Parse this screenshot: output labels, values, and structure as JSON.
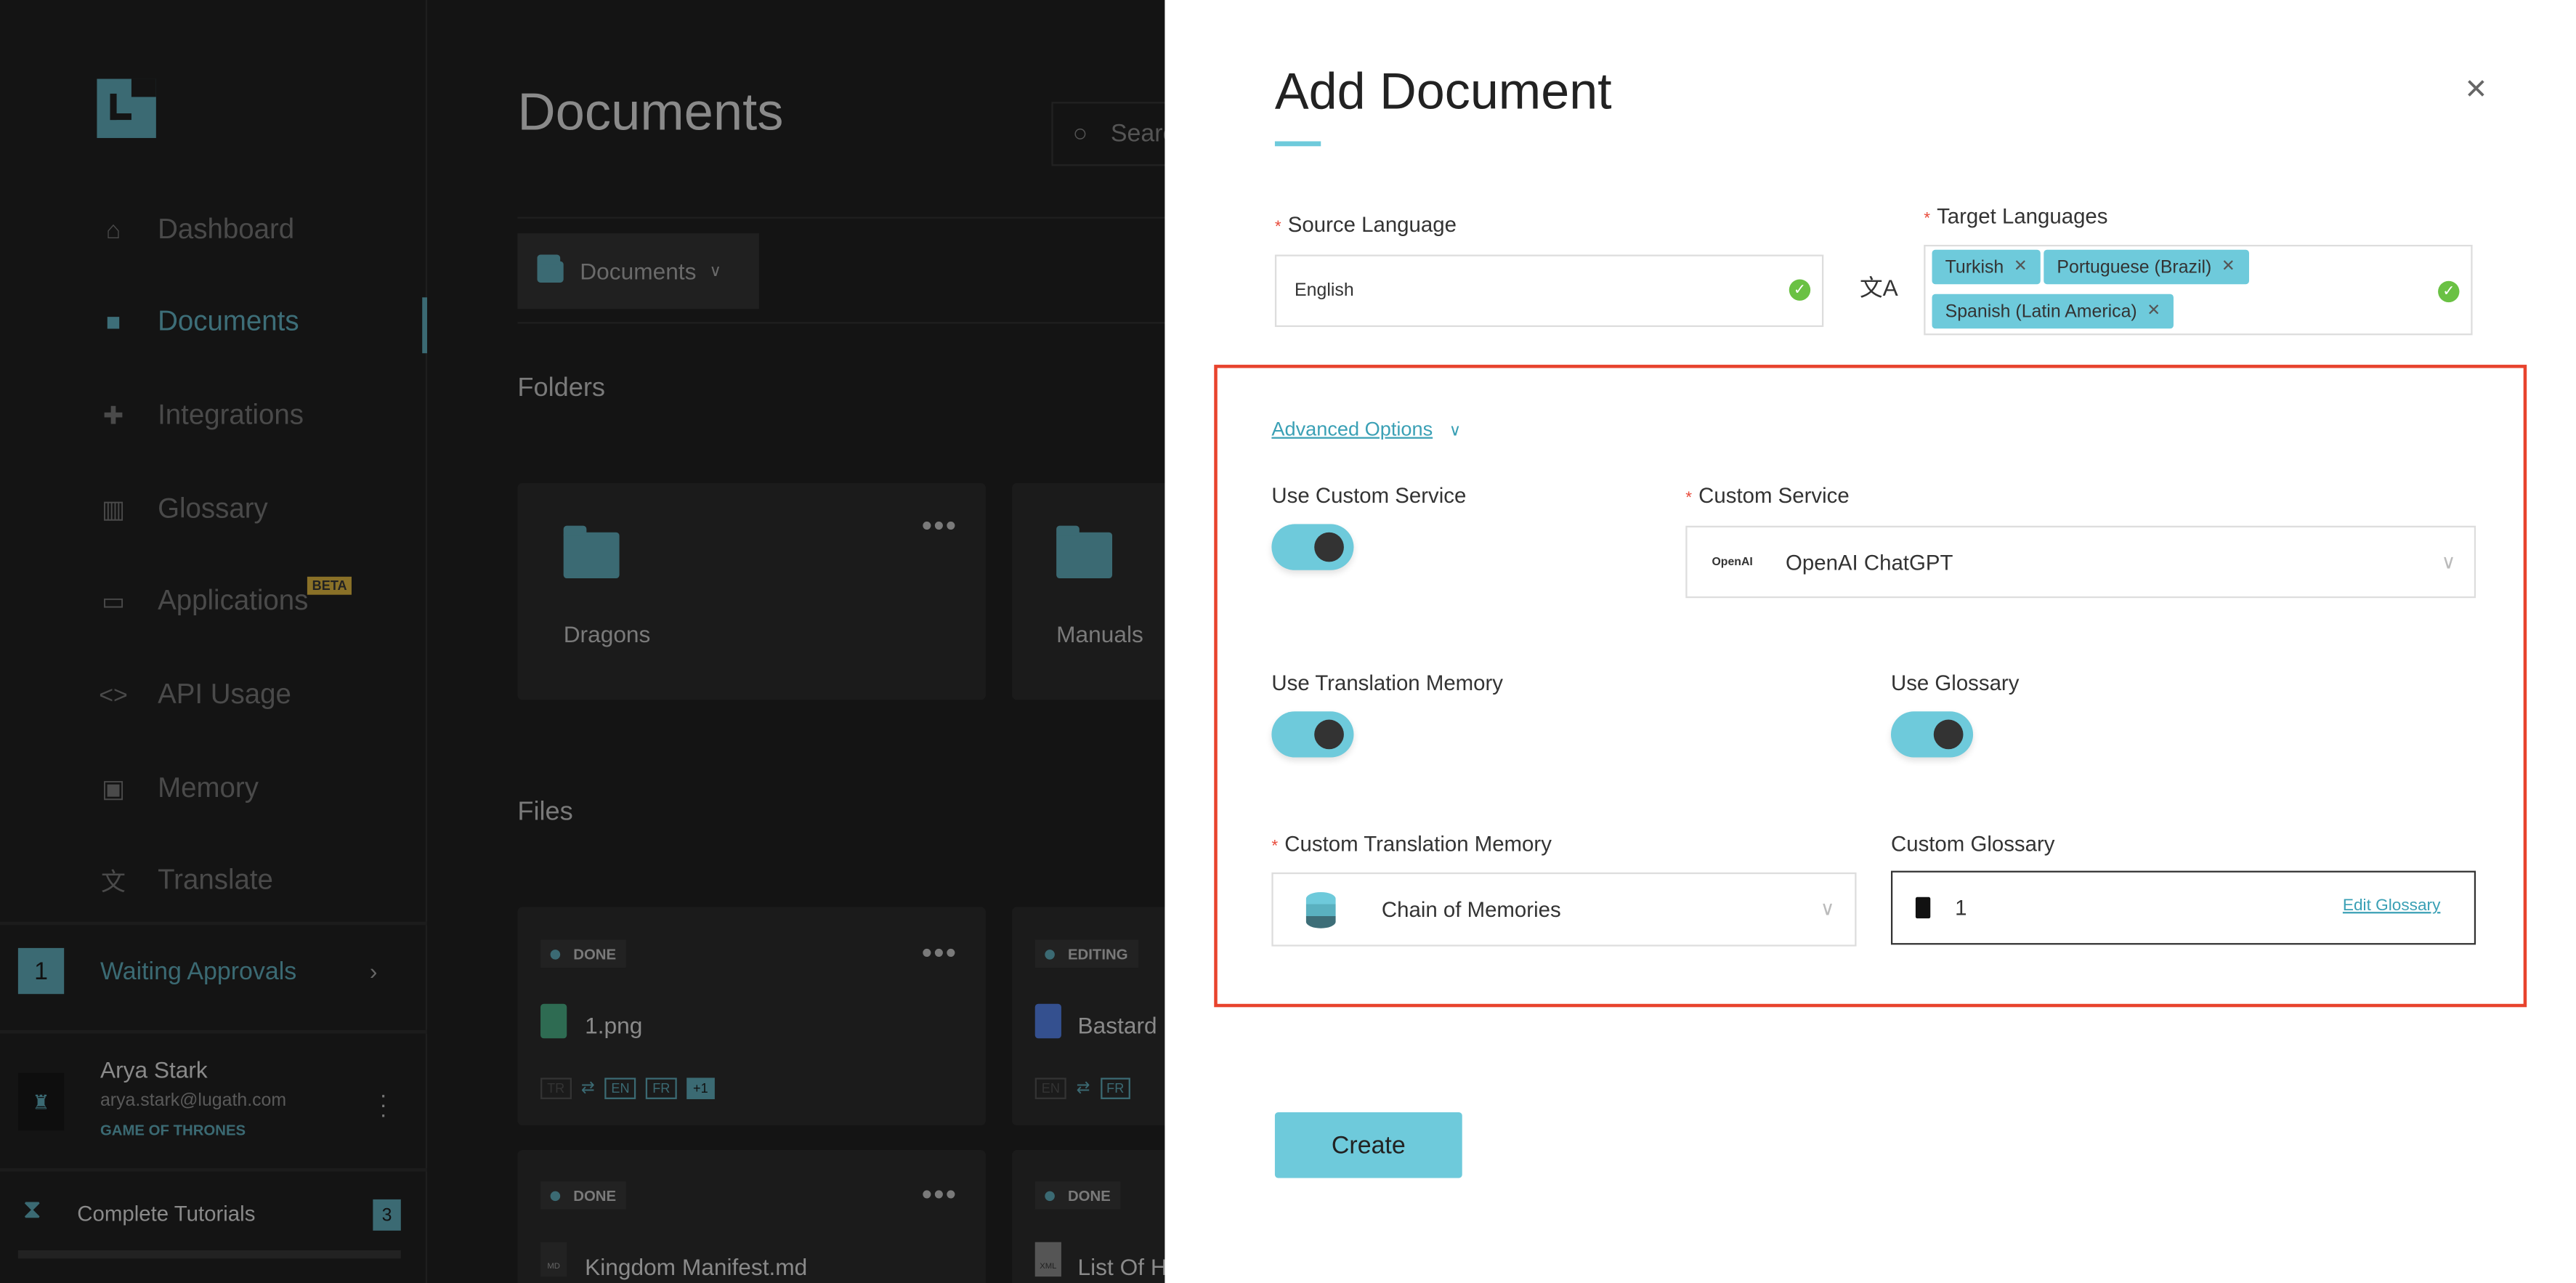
{
  "sidebar": {
    "items": [
      {
        "label": "Dashboard",
        "icon": "home-icon"
      },
      {
        "label": "Documents",
        "icon": "folder-icon",
        "active": true
      },
      {
        "label": "Integrations",
        "icon": "puzzle-icon"
      },
      {
        "label": "Glossary",
        "icon": "book-icon"
      },
      {
        "label": "Applications",
        "icon": "devices-icon",
        "badge": "BETA"
      },
      {
        "label": "API Usage",
        "icon": "code-icon"
      },
      {
        "label": "Memory",
        "icon": "chip-icon"
      },
      {
        "label": "Translate",
        "icon": "translate-icon"
      }
    ],
    "approvals": {
      "count": "1",
      "label": "Waiting Approvals"
    },
    "user": {
      "name": "Arya Stark",
      "email": "arya.stark@lugath.com",
      "org": "GAME OF THRONES"
    },
    "tutorials": {
      "label": "Complete Tutorials",
      "count": "3"
    }
  },
  "main": {
    "title": "Documents",
    "search_placeholder": "Search",
    "breadcrumb": "Documents",
    "folders_heading": "Folders",
    "folders": [
      "Dragons",
      "Manuals"
    ],
    "files_heading": "Files",
    "files": [
      {
        "status": "DONE",
        "name": "1.png",
        "langs": [
          "TR",
          "EN",
          "FR",
          "+1"
        ]
      },
      {
        "status": "EDITING",
        "name": "Bastard",
        "langs": [
          "EN",
          "FR"
        ]
      },
      {
        "status": "DONE",
        "name": "Kingdom Manifest.md",
        "type": "MD"
      },
      {
        "status": "DONE",
        "name": "List Of H",
        "type": "XML"
      }
    ]
  },
  "modal": {
    "title": "Add Document",
    "source_label": "Source Language",
    "source_value": "English",
    "target_label": "Target Languages",
    "target_tags": [
      "Turkish",
      "Portuguese (Brazil)",
      "Spanish (Latin America)"
    ],
    "advanced_label": "Advanced Options",
    "use_custom_service_label": "Use Custom Service",
    "use_custom_service": true,
    "custom_service_label": "Custom Service",
    "custom_service_value": "OpenAI ChatGPT",
    "custom_service_logo": "OpenAI",
    "use_tm_label": "Use Translation Memory",
    "use_tm": true,
    "use_glossary_label": "Use Glossary",
    "use_glossary": true,
    "custom_tm_label": "Custom Translation Memory",
    "custom_tm_value": "Chain of Memories",
    "custom_glossary_label": "Custom Glossary",
    "custom_glossary_value": "1",
    "edit_glossary_label": "Edit Glossary",
    "create_label": "Create",
    "colors": {
      "accent": "#6ecadb",
      "highlight_border": "#e8432d",
      "link": "#3aa0b5"
    }
  }
}
